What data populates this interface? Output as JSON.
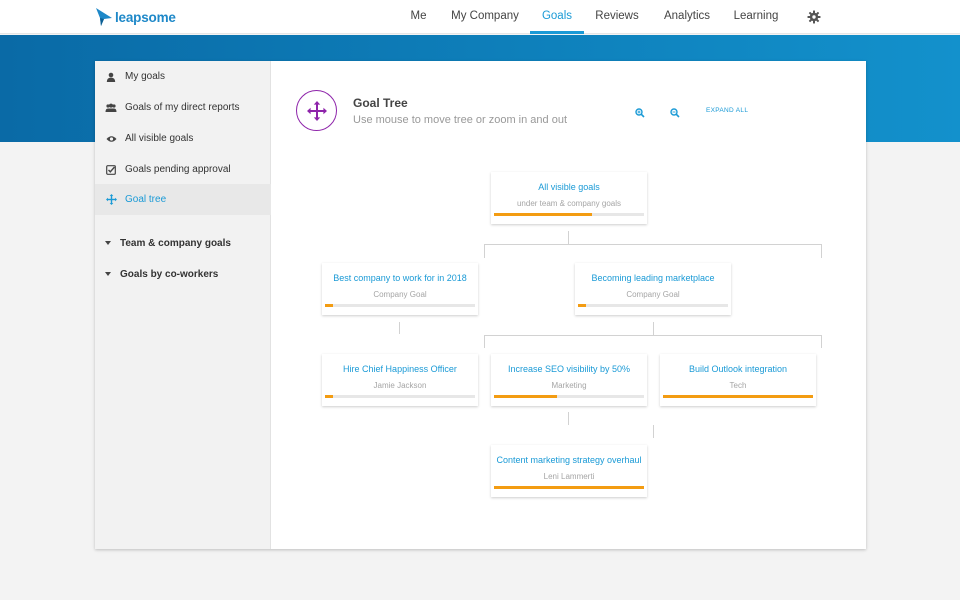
{
  "app": {
    "brand": "leapsome",
    "brand_color": "#1e88c8",
    "accent": "#1a9ad6"
  },
  "nav": {
    "items": [
      {
        "label": "Me",
        "active": false
      },
      {
        "label": "My Company",
        "active": false
      },
      {
        "label": "Goals",
        "active": true
      },
      {
        "label": "Reviews",
        "active": false
      },
      {
        "label": "Analytics",
        "active": false
      },
      {
        "label": "Learning",
        "active": false
      }
    ],
    "settings_icon": "gear-icon"
  },
  "sidebar": {
    "items": [
      {
        "label": "My goals",
        "icon": "user-icon"
      },
      {
        "label": "Goals of my direct reports",
        "icon": "users-icon"
      },
      {
        "label": "All visible goals",
        "icon": "eye-icon"
      },
      {
        "label": "Goals pending approval",
        "icon": "check-square-icon"
      },
      {
        "label": "Goal tree",
        "icon": "move-icon",
        "active": true
      }
    ],
    "groups": [
      {
        "label": "Team & company goals",
        "icon": "caret-down-icon"
      },
      {
        "label": "Goals by co-workers",
        "icon": "caret-down-icon"
      }
    ]
  },
  "tree": {
    "title": "Goal Tree",
    "subtitle": "Use mouse to move tree or zoom in and out",
    "zoom_in_icon": "zoom-in-icon",
    "zoom_out_icon": "zoom-out-icon",
    "expand_all": "EXPAND ALL",
    "progress_color": "#f39c12",
    "nodes": [
      {
        "title": "All visible goals",
        "subtitle": "under team & company goals",
        "progress": 0.65
      },
      {
        "title": "Best company to work for in 2018",
        "subtitle": "Company Goal",
        "progress": 0.05
      },
      {
        "title": "Becoming leading marketplace",
        "subtitle": "Company Goal",
        "progress": 0.05
      },
      {
        "title": "Hire Chief Happiness Officer",
        "subtitle": "Jamie Jackson",
        "progress": 0.05
      },
      {
        "title": "Increase SEO visibility by 50%",
        "subtitle": "Marketing",
        "progress": 0.42
      },
      {
        "title": "Build Outlook integration",
        "subtitle": "Tech",
        "progress": 1.0
      },
      {
        "title": "Content marketing strategy overhaul",
        "subtitle": "Leni Lammerti",
        "progress": 1.0
      }
    ]
  }
}
